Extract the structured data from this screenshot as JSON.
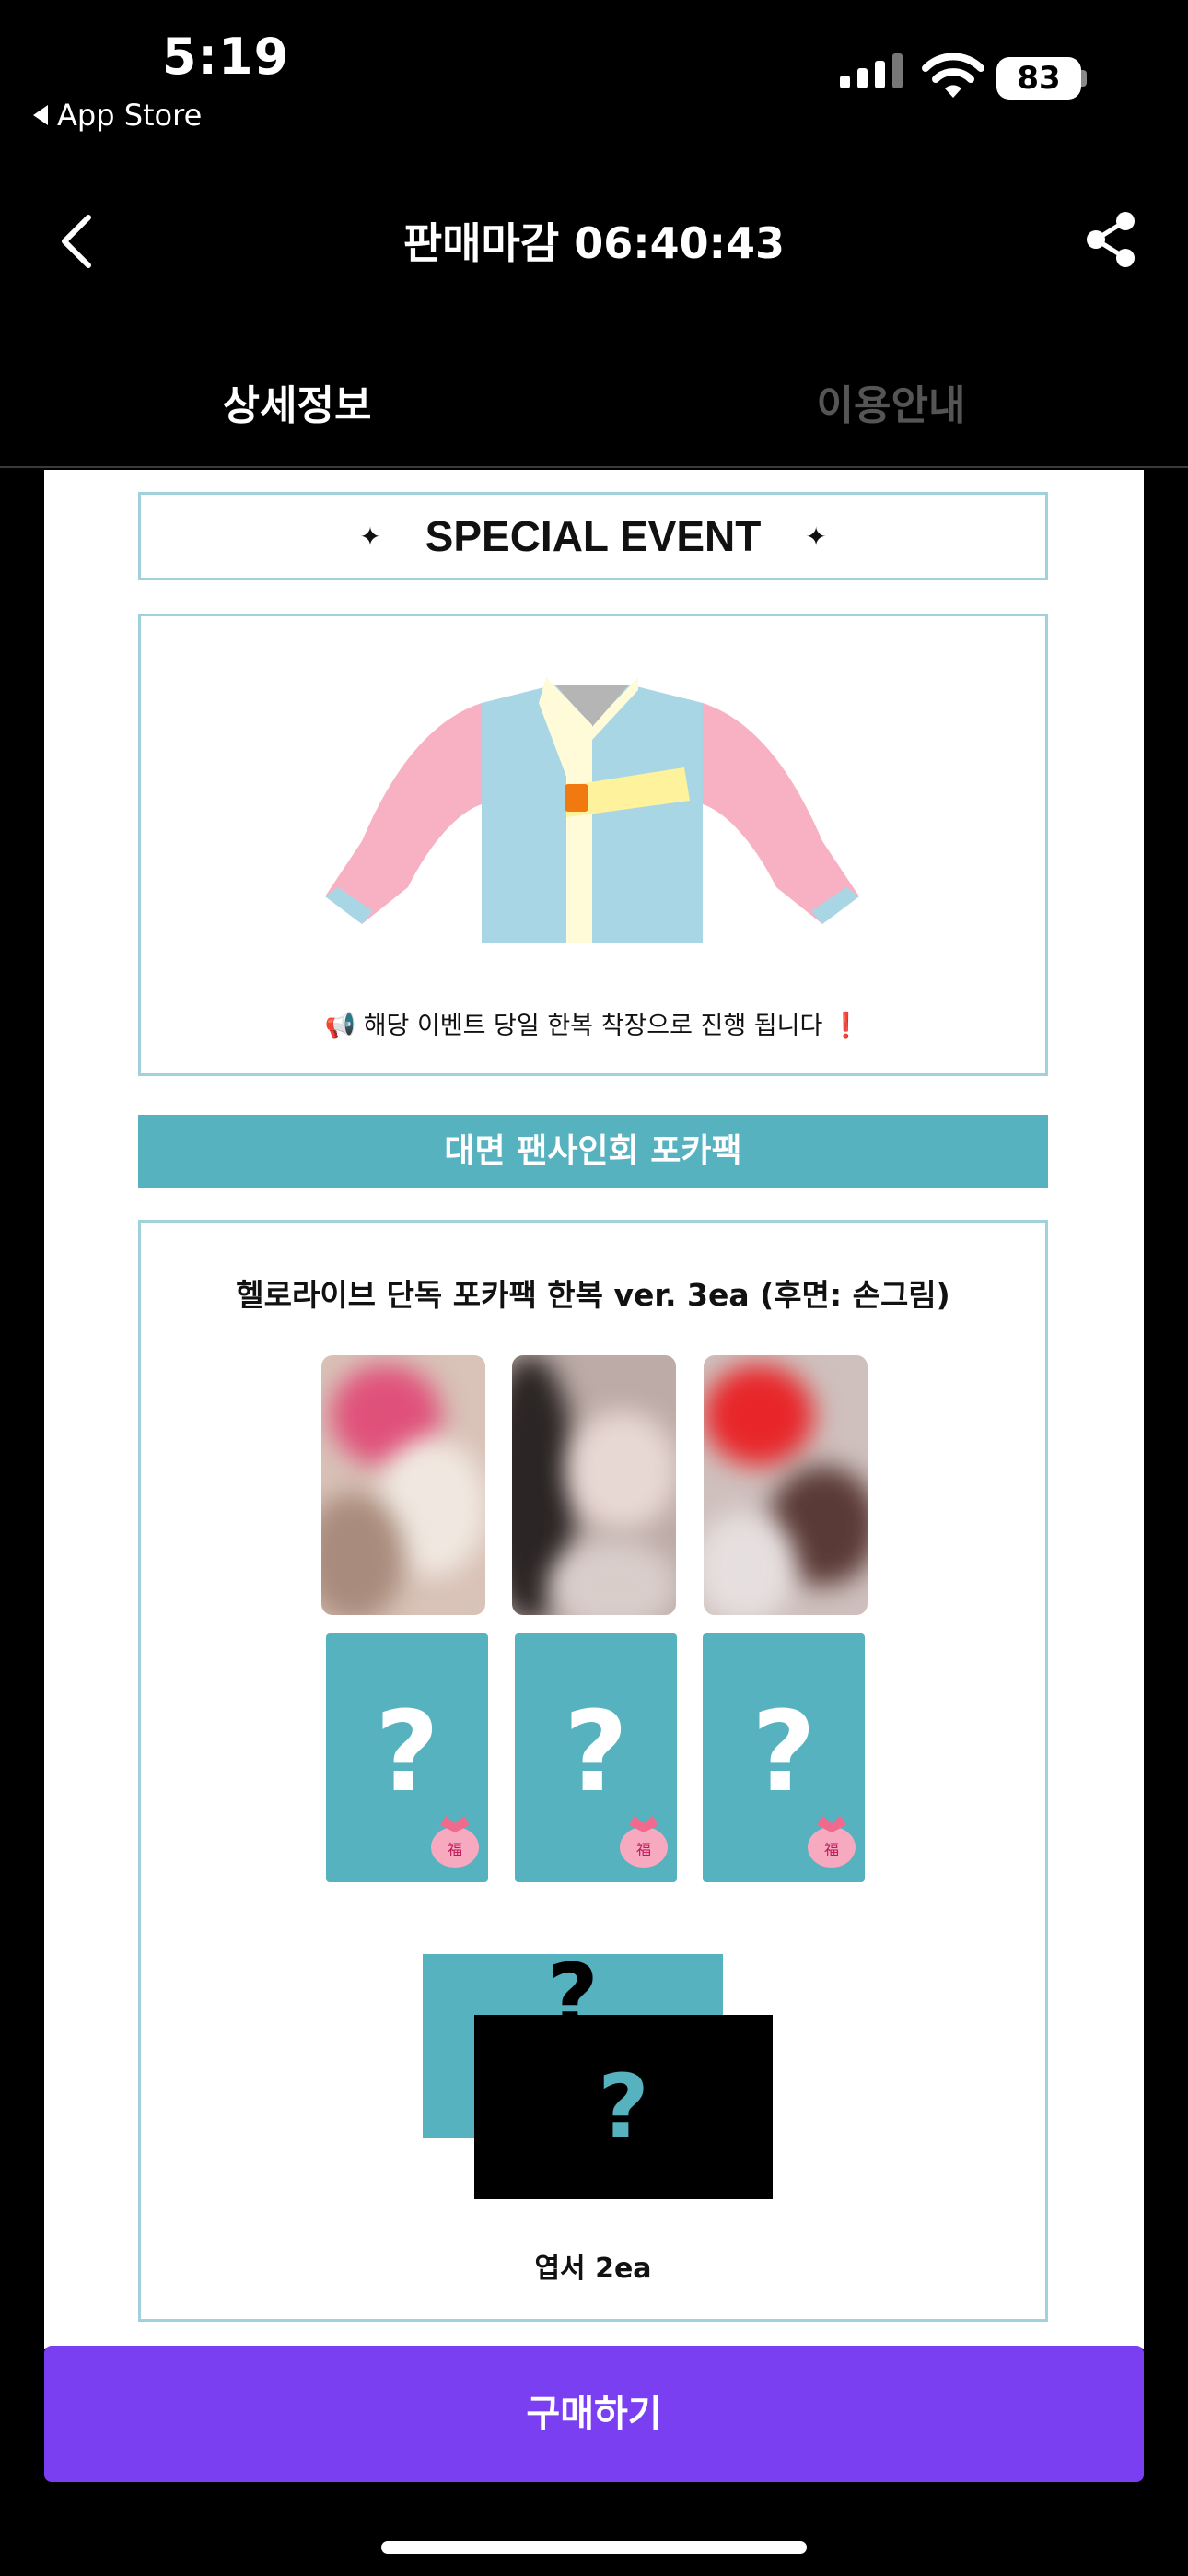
{
  "status_bar": {
    "time": "5:19",
    "back_app": "App Store",
    "battery": "83"
  },
  "header": {
    "title": "판매마감 06:40:43"
  },
  "tabs": [
    {
      "label": "상세정보",
      "active": true
    },
    {
      "label": "이용안내",
      "active": false
    }
  ],
  "event": {
    "title": "SPECIAL EVENT",
    "sparkle": "✦",
    "notice": "해당 이벤트 당일 한복 착장으로 진행 됩니다",
    "notice_icon": "📢",
    "warning_mark": "❗"
  },
  "photocard_section": {
    "banner": "대면 팬사인회 포카팩",
    "title": "헬로라이브 단독 포카팩 한복 ver. 3ea (후면: 손그림)",
    "question_mark": "?",
    "bag_char": "福",
    "postcard_label": "엽서 2ea"
  },
  "buy_button": {
    "label": "구매하기"
  },
  "colors": {
    "accent": "#57b2c0",
    "purple": "#7b3ff2",
    "border": "#9fd2da"
  }
}
